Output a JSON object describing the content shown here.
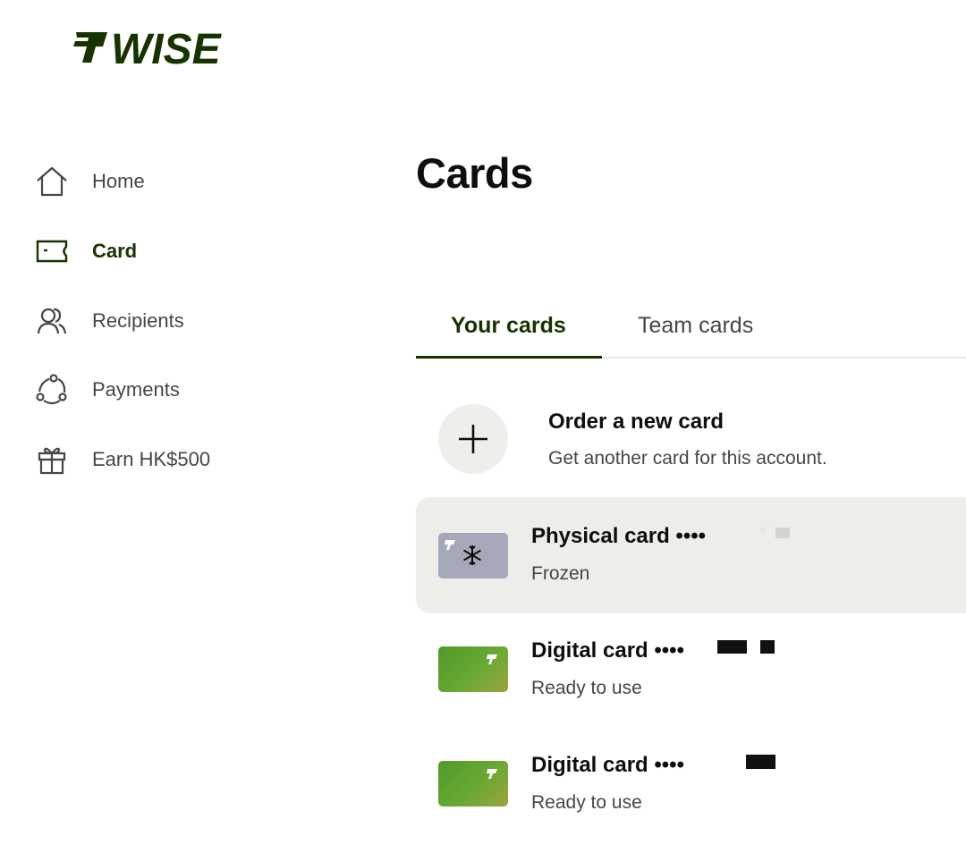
{
  "brand": {
    "logo_text": "WISE",
    "color": "#163300"
  },
  "sidebar": {
    "items": [
      {
        "label": "Home",
        "icon": "home-icon",
        "active": false
      },
      {
        "label": "Card",
        "icon": "card-icon",
        "active": true
      },
      {
        "label": "Recipients",
        "icon": "recipients-icon",
        "active": false
      },
      {
        "label": "Payments",
        "icon": "payments-icon",
        "active": false
      },
      {
        "label": "Earn HK$500",
        "icon": "gift-icon",
        "active": false
      }
    ]
  },
  "main": {
    "title": "Cards",
    "tabs": [
      {
        "label": "Your cards",
        "active": true
      },
      {
        "label": "Team cards",
        "active": false
      }
    ],
    "order": {
      "title": "Order a new card",
      "subtitle": "Get another card for this account."
    },
    "cards": [
      {
        "name": "Physical card ••••",
        "status": "Frozen",
        "style": "frozen",
        "icon": "snowflake-icon"
      },
      {
        "name": "Digital card ••••",
        "status": "Ready to use",
        "style": "green",
        "icon": "wise-flag-icon"
      },
      {
        "name": "Digital card ••••",
        "status": "Ready to use",
        "style": "green",
        "icon": "wise-flag-icon"
      }
    ]
  },
  "colors": {
    "accent": "#163300",
    "text_secondary": "#454745",
    "highlight_bg": "#ededea",
    "frozen_card": "#a5a8b8",
    "green_card": "#6aa834"
  }
}
